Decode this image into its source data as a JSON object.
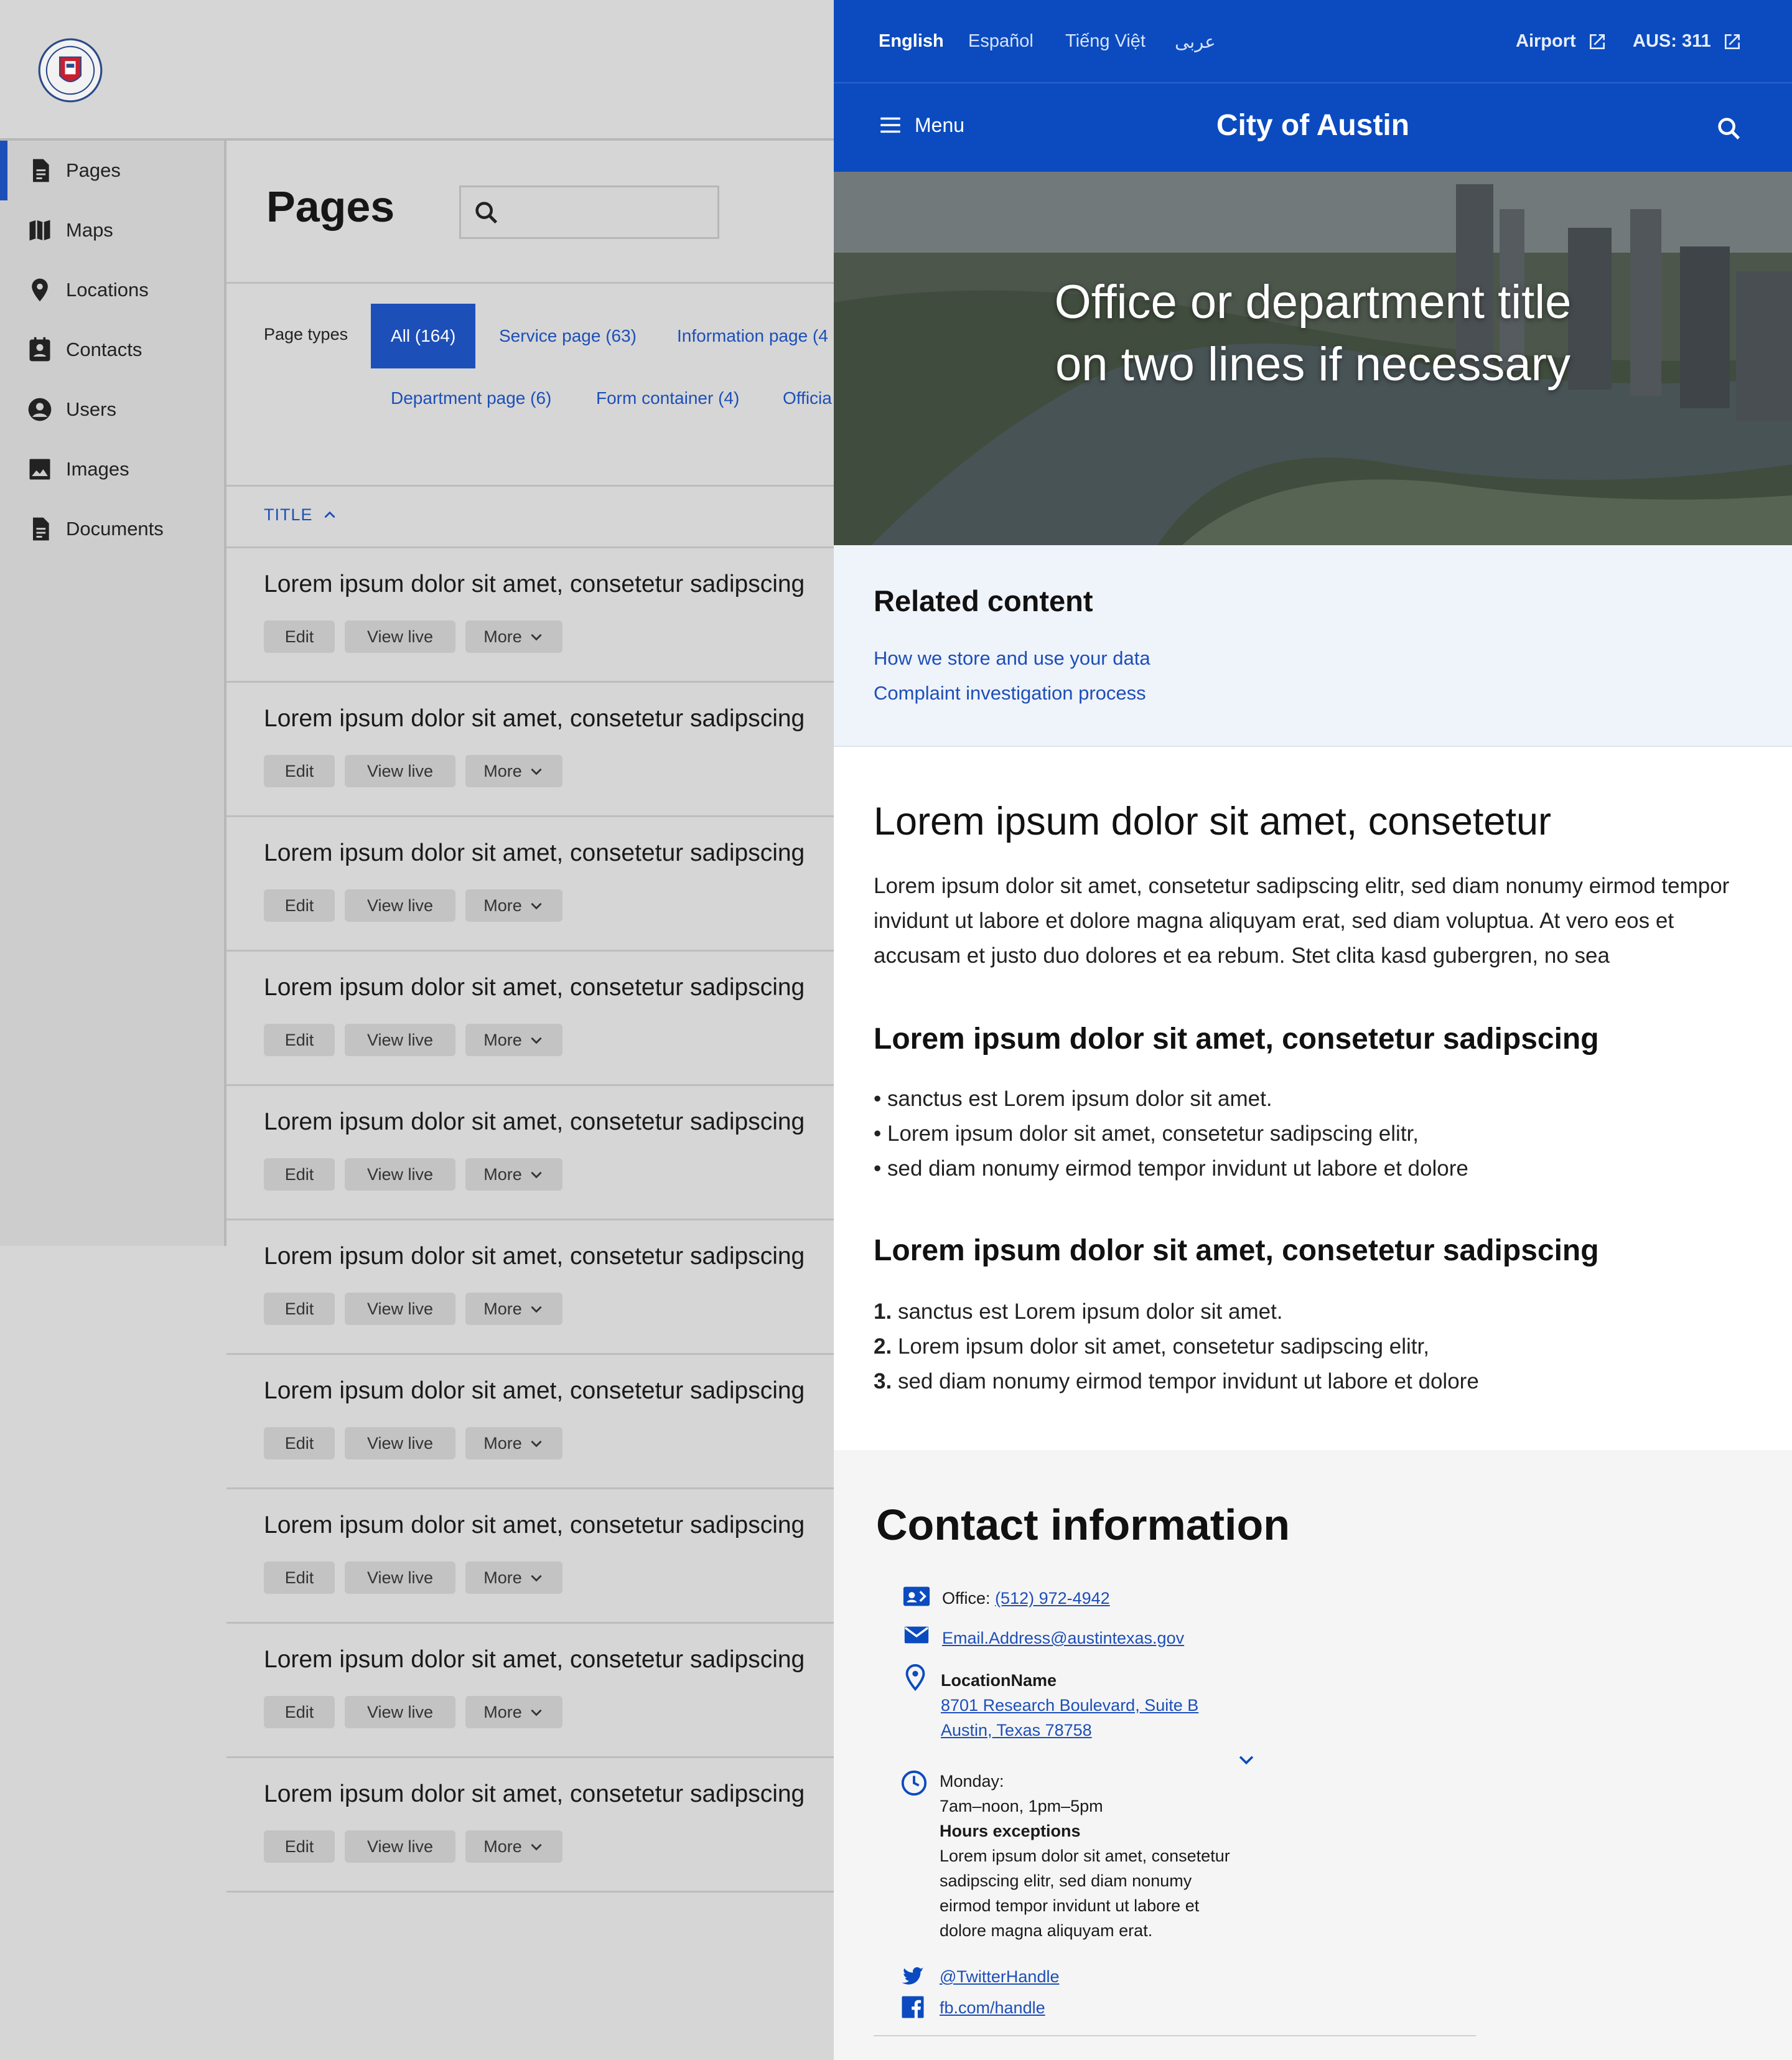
{
  "admin": {
    "sidebar": [
      {
        "label": "Pages",
        "icon": "document-icon"
      },
      {
        "label": "Maps",
        "icon": "map-icon"
      },
      {
        "label": "Locations",
        "icon": "location-pin-icon"
      },
      {
        "label": "Contacts",
        "icon": "contact-card-icon"
      },
      {
        "label": "Users",
        "icon": "user-icon"
      },
      {
        "label": "Images",
        "icon": "image-icon"
      },
      {
        "label": "Documents",
        "icon": "document-icon"
      }
    ],
    "page_title": "Pages",
    "page_types_label": "Page types",
    "page_types": [
      "All (164)",
      "Service page (63)",
      "Information page (4",
      "Department page (6)",
      "Form container (4)",
      "Officia"
    ],
    "sort_label": "TITLE",
    "rows": [
      "Lorem ipsum dolor sit amet, consetetur sadipscing",
      "Lorem ipsum dolor sit amet, consetetur sadipscing",
      "Lorem ipsum dolor sit amet, consetetur sadipscing",
      "Lorem ipsum dolor sit amet, consetetur sadipscing",
      "Lorem ipsum dolor sit amet, consetetur sadipscing",
      "Lorem ipsum dolor sit amet, consetetur sadipscing",
      "Lorem ipsum dolor sit amet, consetetur sadipscing",
      "Lorem ipsum dolor sit amet, consetetur sadipscing",
      "Lorem ipsum dolor sit amet, consetetur sadipscing",
      "Lorem ipsum dolor sit amet, consetetur sadipscing"
    ],
    "row_actions": {
      "edit": "Edit",
      "view_live": "View live",
      "more": "More"
    }
  },
  "site": {
    "languages": [
      "English",
      "Español",
      "Tiếng Việt",
      "عربى"
    ],
    "util_links": [
      "Airport",
      "AUS: 311"
    ],
    "menu_label": "Menu",
    "site_name": "City of Austin",
    "hero_title_line1": "Office or department title",
    "hero_title_line2": "on two lines if necessary",
    "related": {
      "heading": "Related content",
      "links": [
        "How we store and use your data",
        "Complaint investigation process"
      ]
    },
    "content": {
      "h1": "Lorem ipsum dolor sit amet, consetetur",
      "paragraph": "Lorem ipsum dolor sit amet, consetetur sadipscing elitr, sed diam nonumy eirmod tempor invidunt ut labore et dolore magna aliquyam erat, sed diam voluptua. At vero eos et accusam et justo duo dolores et ea rebum. Stet clita kasd gubergren, no sea",
      "h2_bullets": "Lorem ipsum dolor sit amet, consetetur sadipscing",
      "bullets": [
        "sanctus est Lorem ipsum dolor sit amet.",
        "Lorem ipsum dolor sit amet, consetetur sadipscing elitr,",
        "sed diam nonumy eirmod tempor invidunt ut labore et dolore"
      ],
      "h2_numbers": "Lorem ipsum dolor sit amet, consetetur sadipscing",
      "numbered": [
        "sanctus est Lorem ipsum dolor sit amet.",
        "Lorem ipsum dolor sit amet, consetetur sadipscing elitr,",
        "sed diam nonumy eirmod tempor invidunt ut labore et dolore"
      ],
      "bullet_mark": "•",
      "number_marks": [
        "1.",
        "2.",
        "3."
      ]
    },
    "contact": {
      "heading": "Contact information",
      "office_label": "Office:",
      "office_phone": "(512) 972-4942",
      "email": "Email.Address@austintexas.gov",
      "location_name": "LocationName",
      "address_line1": "8701 Research Boulevard, Suite B",
      "address_line2": "Austin, Texas 78758",
      "hours_day": "Monday:",
      "hours_time": "7am–noon, 1pm–5pm",
      "exceptions_heading": "Hours exceptions",
      "exceptions_text": [
        "Lorem ipsum dolor sit amet, consetetur",
        "sadipscing elitr, sed diam nonumy",
        "eirmod tempor invidunt ut labore et",
        "dolore magna aliquyam erat."
      ],
      "twitter": "@TwitterHandle",
      "facebook": "fb.com/handle"
    }
  },
  "colors": {
    "brand_blue": "#0b4bbf",
    "link_blue": "#1d4fb8",
    "admin_bg": "#d6d6d6"
  }
}
